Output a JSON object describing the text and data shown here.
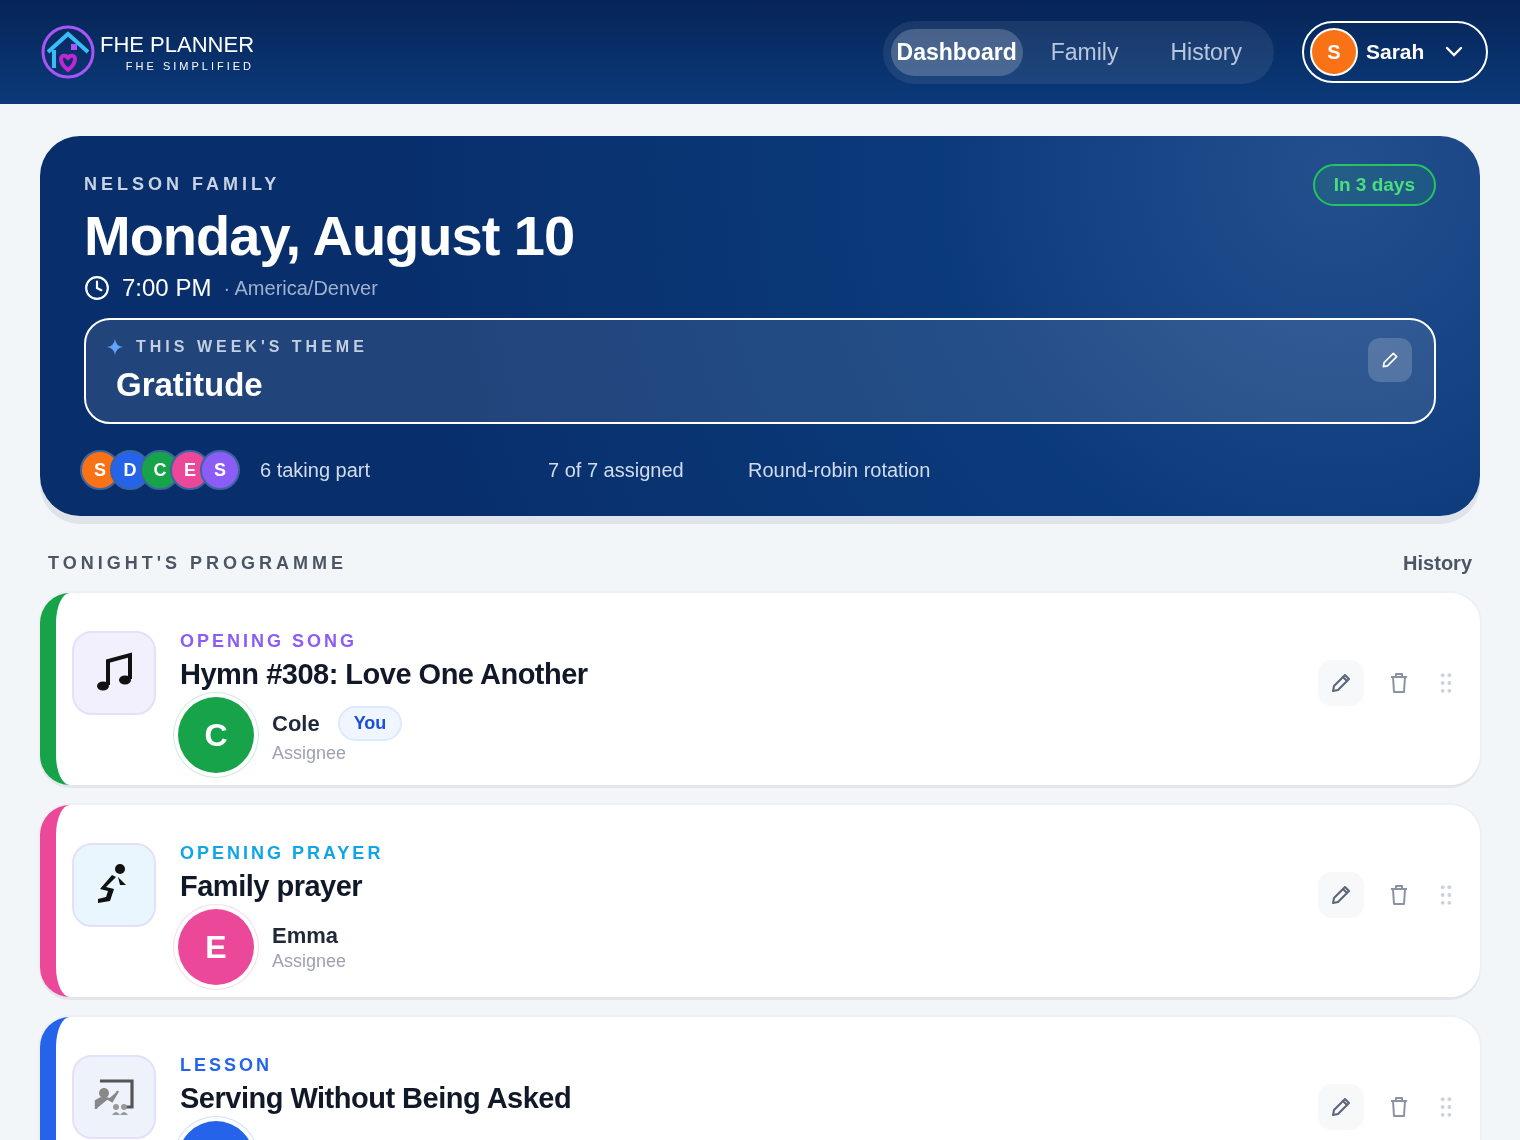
{
  "header": {
    "brand": "FHE PLANNER",
    "tagline": "FHE SIMPLIFIED",
    "tabs": [
      {
        "label": "Dashboard",
        "selected": true
      },
      {
        "label": "Family",
        "selected": false
      },
      {
        "label": "History",
        "selected": false
      }
    ],
    "user": {
      "initial": "S",
      "name": "Sarah",
      "color": "#f97316"
    }
  },
  "hero": {
    "family": "NELSON FAMILY",
    "date": "Monday, August 10",
    "time": "7:00 PM",
    "timezone": "· America/Denver",
    "badge": "In 3 days",
    "theme": {
      "label": "THIS WEEK'S THEME",
      "value": "Gratitude"
    },
    "participants": [
      {
        "initial": "S",
        "color": "#f97316"
      },
      {
        "initial": "D",
        "color": "#2563eb"
      },
      {
        "initial": "C",
        "color": "#16a34a"
      },
      {
        "initial": "E",
        "color": "#ec4899"
      },
      {
        "initial": "S",
        "color": "#8b5cf6"
      }
    ],
    "stats": [
      "6 taking part",
      "7 of 7 assigned",
      "Round-robin rotation"
    ]
  },
  "programme": {
    "title": "TONIGHT'S PROGRAMME",
    "link": "History",
    "items": [
      {
        "kind": "song",
        "color": "#16a34a",
        "label": "OPENING SONG",
        "title": "Hymn #308: Love One Another",
        "assignee": {
          "initial": "C",
          "name": "Cole",
          "role": "Assignee",
          "color": "#16a34a",
          "badge": "You"
        }
      },
      {
        "kind": "prayer",
        "color": "#ec4899",
        "label": "OPENING PRAYER",
        "title": "Family prayer",
        "assignee": {
          "initial": "E",
          "name": "Emma",
          "role": "Assignee",
          "color": "#ec4899"
        }
      },
      {
        "kind": "lesson",
        "color": "#2563eb",
        "label": "LESSON",
        "title": "Serving Without Being Asked",
        "assignee": {
          "color": "#2563eb"
        }
      }
    ]
  }
}
